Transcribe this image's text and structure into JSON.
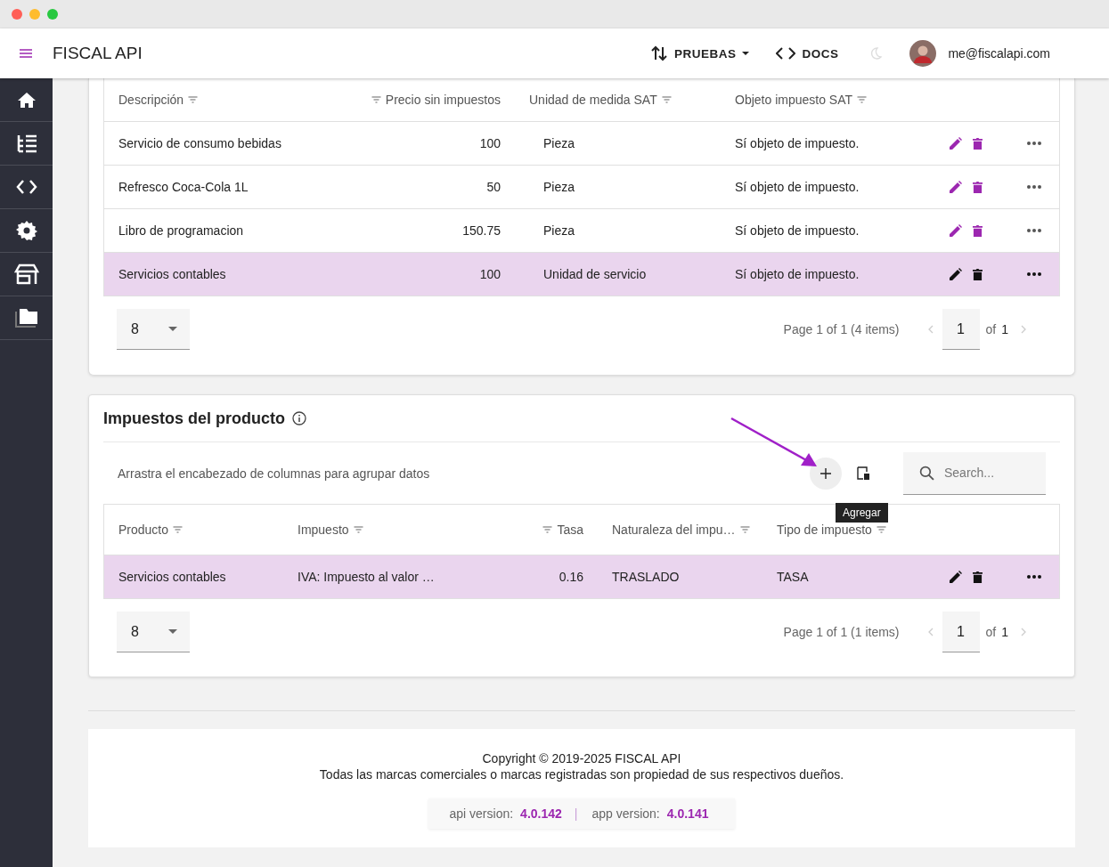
{
  "header": {
    "title": "FISCAL API",
    "environment": "PRUEBAS",
    "docs": "DOCS",
    "user_email": "me@fiscalapi.com"
  },
  "products_table": {
    "columns": [
      {
        "label": "Descripción",
        "kind": "text"
      },
      {
        "label": "Precio sin impuestos",
        "kind": "number"
      },
      {
        "label": "Unidad de medida SAT",
        "kind": "text"
      },
      {
        "label": "Objeto impuesto SAT",
        "kind": "text"
      }
    ],
    "rows": [
      {
        "cells": [
          "Servicio de consumo bebidas",
          "100",
          "Pieza",
          "Sí objeto de impuesto."
        ],
        "selected": false
      },
      {
        "cells": [
          "Refresco Coca-Cola 1L",
          "50",
          "Pieza",
          "Sí objeto de impuesto."
        ],
        "selected": false
      },
      {
        "cells": [
          "Libro de programacion",
          "150.75",
          "Pieza",
          "Sí objeto de impuesto."
        ],
        "selected": false
      },
      {
        "cells": [
          "Servicios contables",
          "100",
          "Unidad de servicio",
          "Sí objeto de impuesto."
        ],
        "selected": true
      }
    ],
    "pager": {
      "page_size": "8",
      "summary": "Page 1 of 1 (4 items)",
      "page": "1",
      "of": "of",
      "total": "1"
    }
  },
  "taxes_panel": {
    "title": "Impuestos del producto",
    "group_hint": "Arrastra el encabezado de columnas para agrupar datos",
    "search": {
      "placeholder": "Search..."
    },
    "tooltip": "Agregar",
    "columns": [
      {
        "label": "Producto",
        "kind": "text"
      },
      {
        "label": "Impuesto",
        "kind": "text"
      },
      {
        "label": "Tasa",
        "kind": "number"
      },
      {
        "label": "Naturaleza del impu…",
        "kind": "text"
      },
      {
        "label": "Tipo de impuesto",
        "kind": "text"
      }
    ],
    "rows": [
      {
        "cells": [
          "Servicios contables",
          "IVA: Impuesto al valor …",
          "0.16",
          "TRASLADO",
          "TASA"
        ],
        "selected": true
      }
    ],
    "pager": {
      "page_size": "8",
      "summary": "Page 1 of 1 (1 items)",
      "page": "1",
      "of": "of",
      "total": "1"
    }
  },
  "footer": {
    "copyright": "Copyright © 2019-2025 FISCAL API",
    "notice": "Todas las marcas comerciales o marcas registradas son propiedad de sus respectivos dueños.",
    "api_label": "api version:",
    "api_version": "4.0.142",
    "separator": "|",
    "app_label": "app version:",
    "app_version": "4.0.141"
  }
}
